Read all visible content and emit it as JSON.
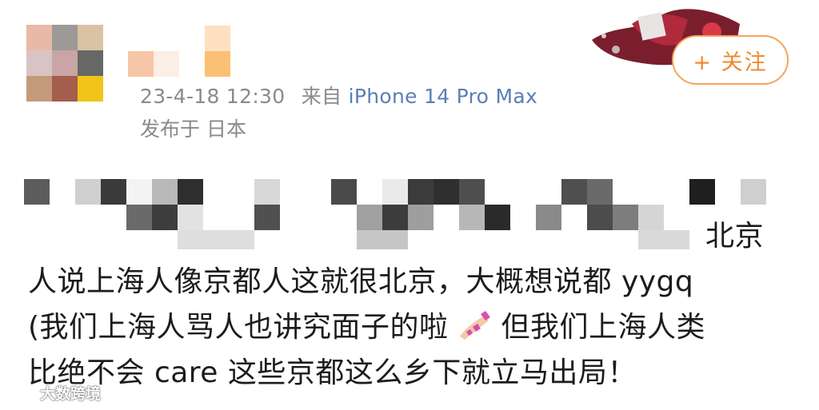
{
  "post": {
    "timestamp": "23-4-18 12:30",
    "source_prefix": "来自",
    "device": "iPhone 14 Pro Max",
    "location": "发布于 日本",
    "follow_label": "+ 关注",
    "lines": [
      "北京",
      "人说上海人像京都人这就很北京，大概想说都 yygq",
      "(我们上海人骂人也讲究面子的啦",
      "但我们上海人类",
      "比绝不会 care 这些京都这么乡下就立马出局！"
    ]
  },
  "icons": {
    "nail": "nail-polish-emoji-icon",
    "watermark_logo": "weibo-logo-icon"
  },
  "watermark": {
    "text": "大数跨境"
  },
  "colors": {
    "follow_border": "#f5a455",
    "follow_text": "#f08a2a",
    "device_link": "#5b7fb4",
    "meta_text": "#8a8a8a"
  }
}
